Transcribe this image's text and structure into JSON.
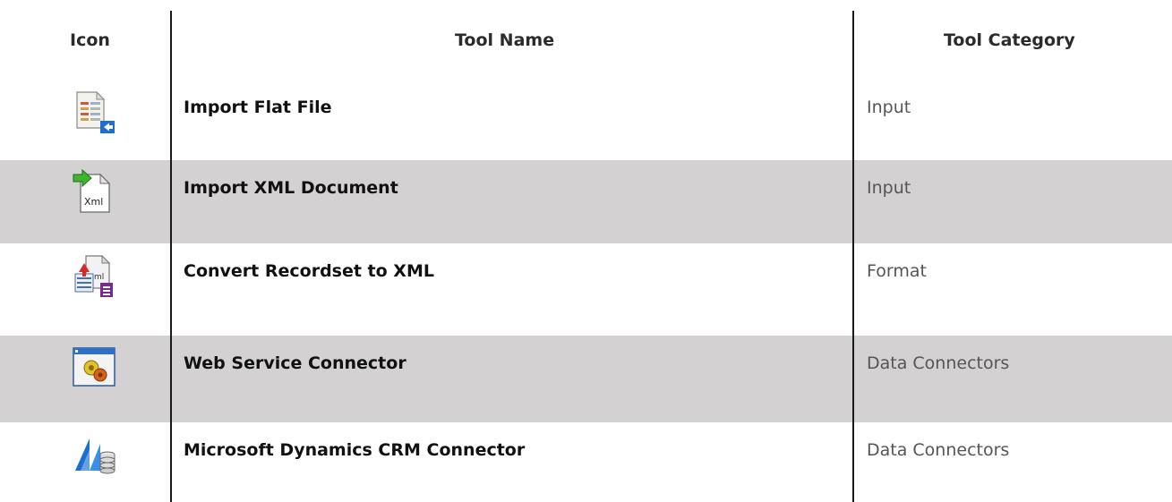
{
  "header": {
    "icon": "Icon",
    "tool_name": "Tool Name",
    "tool_category": "Tool Category"
  },
  "rows": [
    {
      "icon": "flat-file-import-icon",
      "name": "Import Flat File",
      "category": "Input",
      "shaded": false
    },
    {
      "icon": "xml-import-icon",
      "name": "Import XML Document",
      "category": "Input",
      "shaded": true
    },
    {
      "icon": "recordset-to-xml-icon",
      "name": "Convert Recordset to XML",
      "category": "Format",
      "shaded": false
    },
    {
      "icon": "web-service-gear-icon",
      "name": "Web Service Connector",
      "category": "Data Connectors",
      "shaded": true
    },
    {
      "icon": "dynamics-crm-icon",
      "name": "Microsoft Dynamics CRM Connector",
      "category": "Data Connectors",
      "shaded": false
    }
  ],
  "colors": {
    "row_shade": "#d3d1d1",
    "divider": "#1a1a1a",
    "category_text": "#555555"
  }
}
